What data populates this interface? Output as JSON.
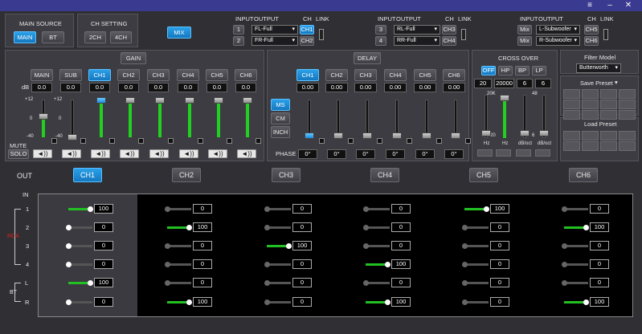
{
  "titlebar": {
    "menu_icon": "≡",
    "min_icon": "–",
    "close_icon": "✕"
  },
  "main_source": {
    "title": "MAIN SOURCE",
    "main": "MAIN",
    "bt": "BT"
  },
  "ch_setting": {
    "title": "CH SETTING",
    "ch2": "2CH",
    "ch4": "4CH"
  },
  "mix_button": "MIX",
  "routing_header": {
    "input": "INPUT",
    "output": "OUTPUT",
    "ch": "CH",
    "link": "LINK"
  },
  "routing": [
    {
      "input": "1",
      "output": "FL-Full",
      "ch": "CH1"
    },
    {
      "input": "2",
      "output": "FR-Full",
      "ch": "CH2"
    },
    {
      "input": "3",
      "output": "RL-Full",
      "ch": "CH3"
    },
    {
      "input": "4",
      "output": "RR-Full",
      "ch": "CH4"
    },
    {
      "input": "Mix",
      "output": "L-Subwoofer",
      "ch": "CH5"
    },
    {
      "input": "Mix",
      "output": "R-Subwoofer",
      "ch": "CH6"
    }
  ],
  "gain": {
    "title": "GAIN",
    "db_label": "dB",
    "channels": [
      "MAIN",
      "SUB",
      "CH1",
      "CH2",
      "CH3",
      "CH4",
      "CH5",
      "CH6"
    ],
    "values": [
      "0.0",
      "0.0",
      "0.0",
      "0.0",
      "0.0",
      "0.0",
      "0.0",
      "0.0"
    ],
    "scale_top": "+12",
    "scale_mid": "0",
    "scale_bot": "-40",
    "levels": [
      0.55,
      0,
      0.98,
      0.98,
      0.98,
      0.98,
      0.98,
      0.98
    ],
    "mute_label": "MUTE",
    "solo_label": "SOLO",
    "speaker_icon": "◄))"
  },
  "delay": {
    "title": "DELAY",
    "channels": [
      "CH1",
      "CH2",
      "CH3",
      "CH4",
      "CH5",
      "CH6"
    ],
    "values": [
      "0.00",
      "0.00",
      "0.00",
      "0.00",
      "0.00",
      "0.00"
    ],
    "units": [
      "MS",
      "CM",
      "INCH"
    ],
    "phase_label": "PHASE",
    "phases": [
      "0°",
      "0°",
      "0°",
      "0°",
      "0°",
      "0°"
    ]
  },
  "crossover": {
    "title": "CROSS OVER",
    "types": [
      "OFF",
      "HP",
      "BP",
      "LP"
    ],
    "hz_low": "20",
    "hz_high": "20000",
    "slope_low": "6",
    "slope_high": "6",
    "scale_top_hz": "20K",
    "scale_bot_hz": "20",
    "scale_top_slope": "48",
    "scale_bot_slope": "6",
    "labels": [
      "Hz",
      "Hz",
      "dB/oct",
      "dB/oct"
    ]
  },
  "filter_model": {
    "title": "Filter Model",
    "value": "Butterworth"
  },
  "save_preset": {
    "title": "Save Preset"
  },
  "load_preset": {
    "title": "Load Preset"
  },
  "out": {
    "label": "OUT",
    "channels": [
      "CH1",
      "CH2",
      "CH3",
      "CH4",
      "CH5",
      "CH6"
    ]
  },
  "in_label": "IN",
  "rca_label": "RCA",
  "bt_label": "BT",
  "inputs": [
    "1",
    "2",
    "3",
    "4",
    "L",
    "R"
  ],
  "matrix": [
    [
      "100",
      "0",
      "0",
      "0",
      "100",
      "0"
    ],
    [
      "0",
      "100",
      "0",
      "0",
      "0",
      "100"
    ],
    [
      "0",
      "0",
      "100",
      "0",
      "0",
      "0"
    ],
    [
      "0",
      "0",
      "0",
      "100",
      "0",
      "0"
    ],
    [
      "100",
      "0",
      "0",
      "0",
      "0",
      "0"
    ],
    [
      "0",
      "100",
      "0",
      "100",
      "0",
      "100"
    ]
  ]
}
